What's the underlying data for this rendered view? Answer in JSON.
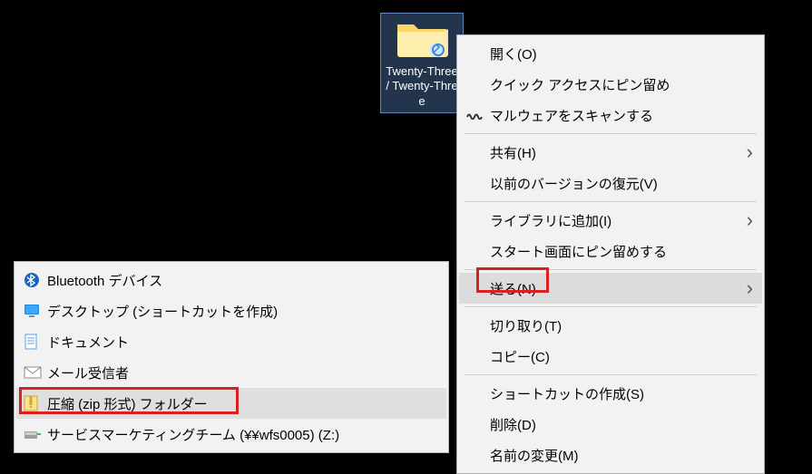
{
  "desktop": {
    "folder_label": "Twenty-Three / Twenty-Three"
  },
  "context_menu": {
    "items": [
      {
        "label": "開く(O)",
        "icon": null,
        "submenu": false
      },
      {
        "label": "クイック アクセスにピン留め",
        "icon": null,
        "submenu": false
      },
      {
        "label": "マルウェアをスキャンする",
        "icon": "wavy",
        "submenu": false
      },
      {
        "sep": true
      },
      {
        "label": "共有(H)",
        "icon": null,
        "submenu": true
      },
      {
        "label": "以前のバージョンの復元(V)",
        "icon": null,
        "submenu": false
      },
      {
        "sep": true
      },
      {
        "label": "ライブラリに追加(I)",
        "icon": null,
        "submenu": true
      },
      {
        "label": "スタート画面にピン留めする",
        "icon": null,
        "submenu": false
      },
      {
        "sep": true
      },
      {
        "label": "送る(N)",
        "icon": null,
        "submenu": true,
        "highlight": true
      },
      {
        "sep": true
      },
      {
        "label": "切り取り(T)",
        "icon": null,
        "submenu": false
      },
      {
        "label": "コピー(C)",
        "icon": null,
        "submenu": false
      },
      {
        "sep": true
      },
      {
        "label": "ショートカットの作成(S)",
        "icon": null,
        "submenu": false
      },
      {
        "label": "削除(D)",
        "icon": null,
        "submenu": false
      },
      {
        "label": "名前の変更(M)",
        "icon": null,
        "submenu": false
      }
    ]
  },
  "send_to_menu": {
    "items": [
      {
        "label": "Bluetooth デバイス",
        "icon": "bluetooth"
      },
      {
        "label": "デスクトップ (ショートカットを作成)",
        "icon": "desktop"
      },
      {
        "label": "ドキュメント",
        "icon": "document"
      },
      {
        "label": "メール受信者",
        "icon": "mail"
      },
      {
        "label": "圧縮 (zip 形式) フォルダー",
        "icon": "zip",
        "highlight": true
      },
      {
        "label": "サービスマーケティングチーム (¥¥wfs0005) (Z:)",
        "icon": "netdrive"
      }
    ]
  }
}
